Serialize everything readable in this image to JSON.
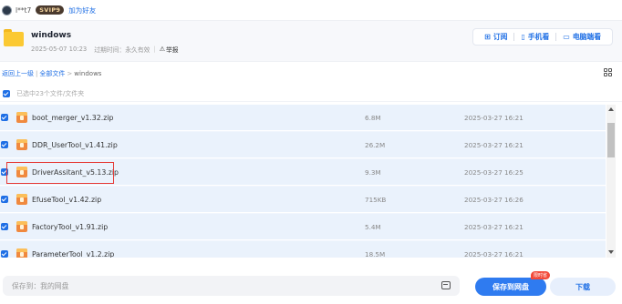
{
  "user": {
    "name": "l**t7",
    "vip_badge": "SVIP9",
    "add_friend": "加为好友"
  },
  "folder": {
    "name": "windows",
    "date": "2025-05-07 10:23",
    "expiry": "过期时间：永久有效",
    "report": "举报"
  },
  "header_actions": [
    {
      "label": "订阅",
      "icon": "subscribe-icon"
    },
    {
      "label": "手机看",
      "icon": "phone-icon"
    },
    {
      "label": "电脑端看",
      "icon": "monitor-icon"
    }
  ],
  "breadcrumb": {
    "back": "返回上一级",
    "all_files": "全部文件",
    "current": "windows"
  },
  "selection": {
    "label": "已选中23个文件/文件夹"
  },
  "files": [
    {
      "name": "boot_merger_v1.32.zip",
      "size": "6.8M",
      "date": "2025-03-27 16:21"
    },
    {
      "name": "DDR_UserTool_v1.41.zip",
      "size": "26.2M",
      "date": "2025-03-27 16:21"
    },
    {
      "name": "DriverAssitant_v5.13.zip",
      "size": "9.3M",
      "date": "2025-03-27 16:25"
    },
    {
      "name": "EfuseTool_v1.42.zip",
      "size": "715KB",
      "date": "2025-03-27 16:26"
    },
    {
      "name": "FactoryTool_v1.91.zip",
      "size": "5.4M",
      "date": "2025-03-27 16:21"
    },
    {
      "name": "ParameterTool_v1.2.zip",
      "size": "18.5M",
      "date": "2025-03-27 16:21"
    }
  ],
  "bottom": {
    "save_to": "保存到：我的网盘",
    "save_button": "保存到网盘",
    "badge": "限时省",
    "download_button": "下载"
  },
  "colors": {
    "accent": "#1f6fe5",
    "row_bg": "#eaf2fc",
    "highlight_border": "#e53935",
    "folder": "#fbc933",
    "zip": "#f0893e"
  }
}
